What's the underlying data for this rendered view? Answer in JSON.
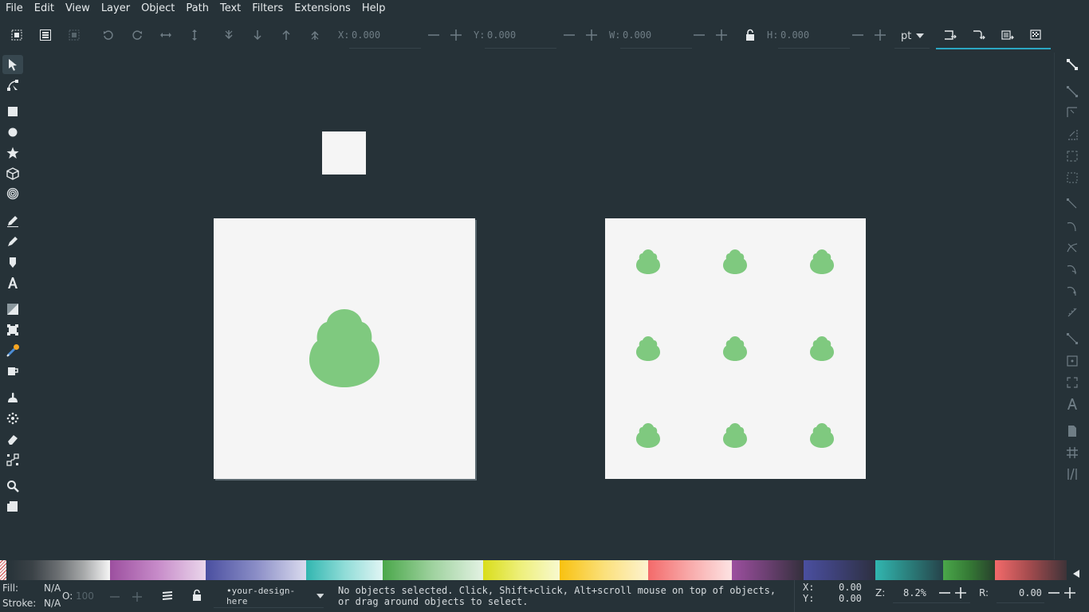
{
  "menu": [
    "File",
    "Edit",
    "View",
    "Layer",
    "Object",
    "Path",
    "Text",
    "Filters",
    "Extensions",
    "Help"
  ],
  "toolbar": {
    "x_label": "X:",
    "x_value": "0.000",
    "y_label": "Y:",
    "y_value": "0.000",
    "w_label": "W:",
    "w_value": "0.000",
    "h_label": "H:",
    "h_value": "0.000",
    "unit": "pt"
  },
  "icons": {
    "select_all": "select-all-icon",
    "select_all_layers": "select-all-layers-icon",
    "deselect": "deselect-icon",
    "rotate_ccw": "rotate-ccw-icon",
    "rotate_cw": "rotate-cw-icon",
    "flip_h": "flip-horizontal-icon",
    "flip_v": "flip-vertical-icon",
    "lower_bottom": "lower-to-bottom-icon",
    "lower": "lower-icon",
    "raise": "raise-icon",
    "raise_top": "raise-to-top-icon",
    "lock": "lock-icon"
  },
  "status": {
    "fill_label": "Fill:",
    "fill_value": "N/A",
    "stroke_label": "Stroke:",
    "stroke_value": "N/A",
    "opacity_label": "O:",
    "opacity_value": "100",
    "layer_name": "•your-design-here",
    "message": "No objects selected. Click, Shift+click, Alt+scroll mouse on top of objects, or drag around objects to select.",
    "cursor_x_label": "X:",
    "cursor_x_value": "0.00",
    "cursor_y_label": "Y:",
    "cursor_y_value": "0.00",
    "zoom_label": "Z:",
    "zoom_value": "8.2%",
    "rotation_label": "R:",
    "rotation_value": "0.00"
  },
  "colors": {
    "canvas_bg": "#263238",
    "page": "#f5f5f5",
    "leaf": "#7fc97f",
    "accent": "#2ba7c3"
  },
  "canvas": {
    "small_page": "small-square-page",
    "page1": "design-page-single-leaf",
    "page2": "design-page-leaf-grid"
  }
}
